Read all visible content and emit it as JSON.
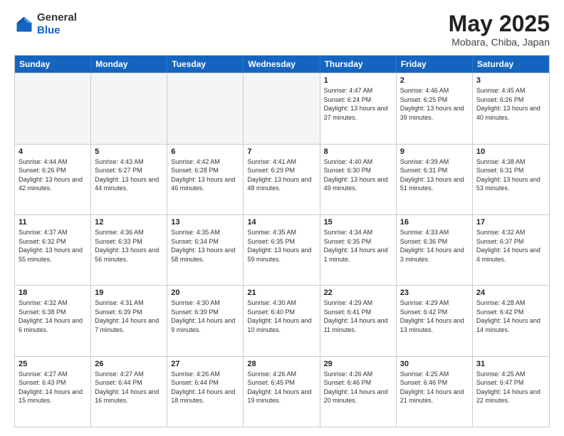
{
  "header": {
    "logo_general": "General",
    "logo_blue": "Blue",
    "month": "May 2025",
    "location": "Mobara, Chiba, Japan"
  },
  "weekdays": [
    "Sunday",
    "Monday",
    "Tuesday",
    "Wednesday",
    "Thursday",
    "Friday",
    "Saturday"
  ],
  "rows": [
    [
      {
        "day": "",
        "text": "",
        "empty": true
      },
      {
        "day": "",
        "text": "",
        "empty": true
      },
      {
        "day": "",
        "text": "",
        "empty": true
      },
      {
        "day": "",
        "text": "",
        "empty": true
      },
      {
        "day": "1",
        "text": "Sunrise: 4:47 AM\nSunset: 6:24 PM\nDaylight: 13 hours and 37 minutes.",
        "empty": false
      },
      {
        "day": "2",
        "text": "Sunrise: 4:46 AM\nSunset: 6:25 PM\nDaylight: 13 hours and 39 minutes.",
        "empty": false
      },
      {
        "day": "3",
        "text": "Sunrise: 4:45 AM\nSunset: 6:26 PM\nDaylight: 13 hours and 40 minutes.",
        "empty": false
      }
    ],
    [
      {
        "day": "4",
        "text": "Sunrise: 4:44 AM\nSunset: 6:26 PM\nDaylight: 13 hours and 42 minutes.",
        "empty": false
      },
      {
        "day": "5",
        "text": "Sunrise: 4:43 AM\nSunset: 6:27 PM\nDaylight: 13 hours and 44 minutes.",
        "empty": false
      },
      {
        "day": "6",
        "text": "Sunrise: 4:42 AM\nSunset: 6:28 PM\nDaylight: 13 hours and 46 minutes.",
        "empty": false
      },
      {
        "day": "7",
        "text": "Sunrise: 4:41 AM\nSunset: 6:29 PM\nDaylight: 13 hours and 48 minutes.",
        "empty": false
      },
      {
        "day": "8",
        "text": "Sunrise: 4:40 AM\nSunset: 6:30 PM\nDaylight: 13 hours and 49 minutes.",
        "empty": false
      },
      {
        "day": "9",
        "text": "Sunrise: 4:39 AM\nSunset: 6:31 PM\nDaylight: 13 hours and 51 minutes.",
        "empty": false
      },
      {
        "day": "10",
        "text": "Sunrise: 4:38 AM\nSunset: 6:31 PM\nDaylight: 13 hours and 53 minutes.",
        "empty": false
      }
    ],
    [
      {
        "day": "11",
        "text": "Sunrise: 4:37 AM\nSunset: 6:32 PM\nDaylight: 13 hours and 55 minutes.",
        "empty": false
      },
      {
        "day": "12",
        "text": "Sunrise: 4:36 AM\nSunset: 6:33 PM\nDaylight: 13 hours and 56 minutes.",
        "empty": false
      },
      {
        "day": "13",
        "text": "Sunrise: 4:35 AM\nSunset: 6:34 PM\nDaylight: 13 hours and 58 minutes.",
        "empty": false
      },
      {
        "day": "14",
        "text": "Sunrise: 4:35 AM\nSunset: 6:35 PM\nDaylight: 13 hours and 59 minutes.",
        "empty": false
      },
      {
        "day": "15",
        "text": "Sunrise: 4:34 AM\nSunset: 6:35 PM\nDaylight: 14 hours and 1 minute.",
        "empty": false
      },
      {
        "day": "16",
        "text": "Sunrise: 4:33 AM\nSunset: 6:36 PM\nDaylight: 14 hours and 3 minutes.",
        "empty": false
      },
      {
        "day": "17",
        "text": "Sunrise: 4:32 AM\nSunset: 6:37 PM\nDaylight: 14 hours and 4 minutes.",
        "empty": false
      }
    ],
    [
      {
        "day": "18",
        "text": "Sunrise: 4:32 AM\nSunset: 6:38 PM\nDaylight: 14 hours and 6 minutes.",
        "empty": false
      },
      {
        "day": "19",
        "text": "Sunrise: 4:31 AM\nSunset: 6:39 PM\nDaylight: 14 hours and 7 minutes.",
        "empty": false
      },
      {
        "day": "20",
        "text": "Sunrise: 4:30 AM\nSunset: 6:39 PM\nDaylight: 14 hours and 9 minutes.",
        "empty": false
      },
      {
        "day": "21",
        "text": "Sunrise: 4:30 AM\nSunset: 6:40 PM\nDaylight: 14 hours and 10 minutes.",
        "empty": false
      },
      {
        "day": "22",
        "text": "Sunrise: 4:29 AM\nSunset: 6:41 PM\nDaylight: 14 hours and 11 minutes.",
        "empty": false
      },
      {
        "day": "23",
        "text": "Sunrise: 4:29 AM\nSunset: 6:42 PM\nDaylight: 14 hours and 13 minutes.",
        "empty": false
      },
      {
        "day": "24",
        "text": "Sunrise: 4:28 AM\nSunset: 6:42 PM\nDaylight: 14 hours and 14 minutes.",
        "empty": false
      }
    ],
    [
      {
        "day": "25",
        "text": "Sunrise: 4:27 AM\nSunset: 6:43 PM\nDaylight: 14 hours and 15 minutes.",
        "empty": false
      },
      {
        "day": "26",
        "text": "Sunrise: 4:27 AM\nSunset: 6:44 PM\nDaylight: 14 hours and 16 minutes.",
        "empty": false
      },
      {
        "day": "27",
        "text": "Sunrise: 4:26 AM\nSunset: 6:44 PM\nDaylight: 14 hours and 18 minutes.",
        "empty": false
      },
      {
        "day": "28",
        "text": "Sunrise: 4:26 AM\nSunset: 6:45 PM\nDaylight: 14 hours and 19 minutes.",
        "empty": false
      },
      {
        "day": "29",
        "text": "Sunrise: 4:26 AM\nSunset: 6:46 PM\nDaylight: 14 hours and 20 minutes.",
        "empty": false
      },
      {
        "day": "30",
        "text": "Sunrise: 4:25 AM\nSunset: 6:46 PM\nDaylight: 14 hours and 21 minutes.",
        "empty": false
      },
      {
        "day": "31",
        "text": "Sunrise: 4:25 AM\nSunset: 6:47 PM\nDaylight: 14 hours and 22 minutes.",
        "empty": false
      }
    ]
  ]
}
